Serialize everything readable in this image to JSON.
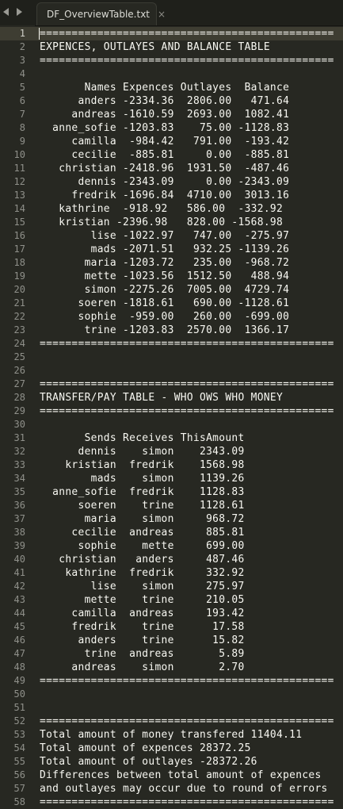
{
  "window": {
    "tab_title": "DF_OverviewTable.txt",
    "tab_close": "×"
  },
  "editor": {
    "current_line": 1,
    "lines": [
      "==============================================",
      "EXPENCES, OUTLAYES AND BALANCE TABLE",
      "==============================================",
      "",
      "       Names Expences Outlayes  Balance",
      "      anders -2334.36  2806.00   471.64",
      "     andreas -1610.59  2693.00  1082.41",
      "  anne_sofie -1203.83    75.00 -1128.83",
      "     camilla  -984.42   791.00  -193.42",
      "     cecilie  -885.81     0.00  -885.81",
      "   christian -2418.96  1931.50  -487.46",
      "      dennis -2343.09     0.00 -2343.09",
      "     fredrik -1696.84  4710.00  3013.16",
      "   kathrine  -918.92   586.00  -332.92",
      "   kristian -2396.98   828.00 -1568.98",
      "        lise -1022.97   747.00  -275.97",
      "        mads -2071.51   932.25 -1139.26",
      "       maria -1203.72   235.00  -968.72",
      "       mette -1023.56  1512.50   488.94",
      "       simon -2275.26  7005.00  4729.74",
      "      soeren -1818.61   690.00 -1128.61",
      "      sophie  -959.00   260.00  -699.00",
      "       trine -1203.83  2570.00  1366.17",
      "==============================================",
      "",
      "",
      "==============================================",
      "TRANSFER/PAY TABLE - WHO OWS WHO MONEY",
      "==============================================",
      "",
      "       Sends Receives ThisAmount",
      "      dennis    simon    2343.09",
      "    kristian  fredrik    1568.98",
      "        mads    simon    1139.26",
      "  anne_sofie  fredrik    1128.83",
      "      soeren    trine    1128.61",
      "       maria    simon     968.72",
      "     cecilie  andreas     885.81",
      "      sophie    mette     699.00",
      "   christian   anders     487.46",
      "    kathrine  fredrik     332.92",
      "        lise    simon     275.97",
      "       mette    trine     210.05",
      "     camilla  andreas     193.42",
      "     fredrik    trine      17.58",
      "      anders    trine      15.82",
      "       trine  andreas       5.89",
      "     andreas    simon       2.70",
      "==============================================",
      "",
      "",
      "==============================================",
      "Total amount of money transfered 11404.11",
      "Total amount of expences 28372.25",
      "Total amount of outlayes -28372.26",
      "Differences between total amount of expences",
      "and outlayes may occur due to round of errors",
      "=============================================="
    ]
  }
}
